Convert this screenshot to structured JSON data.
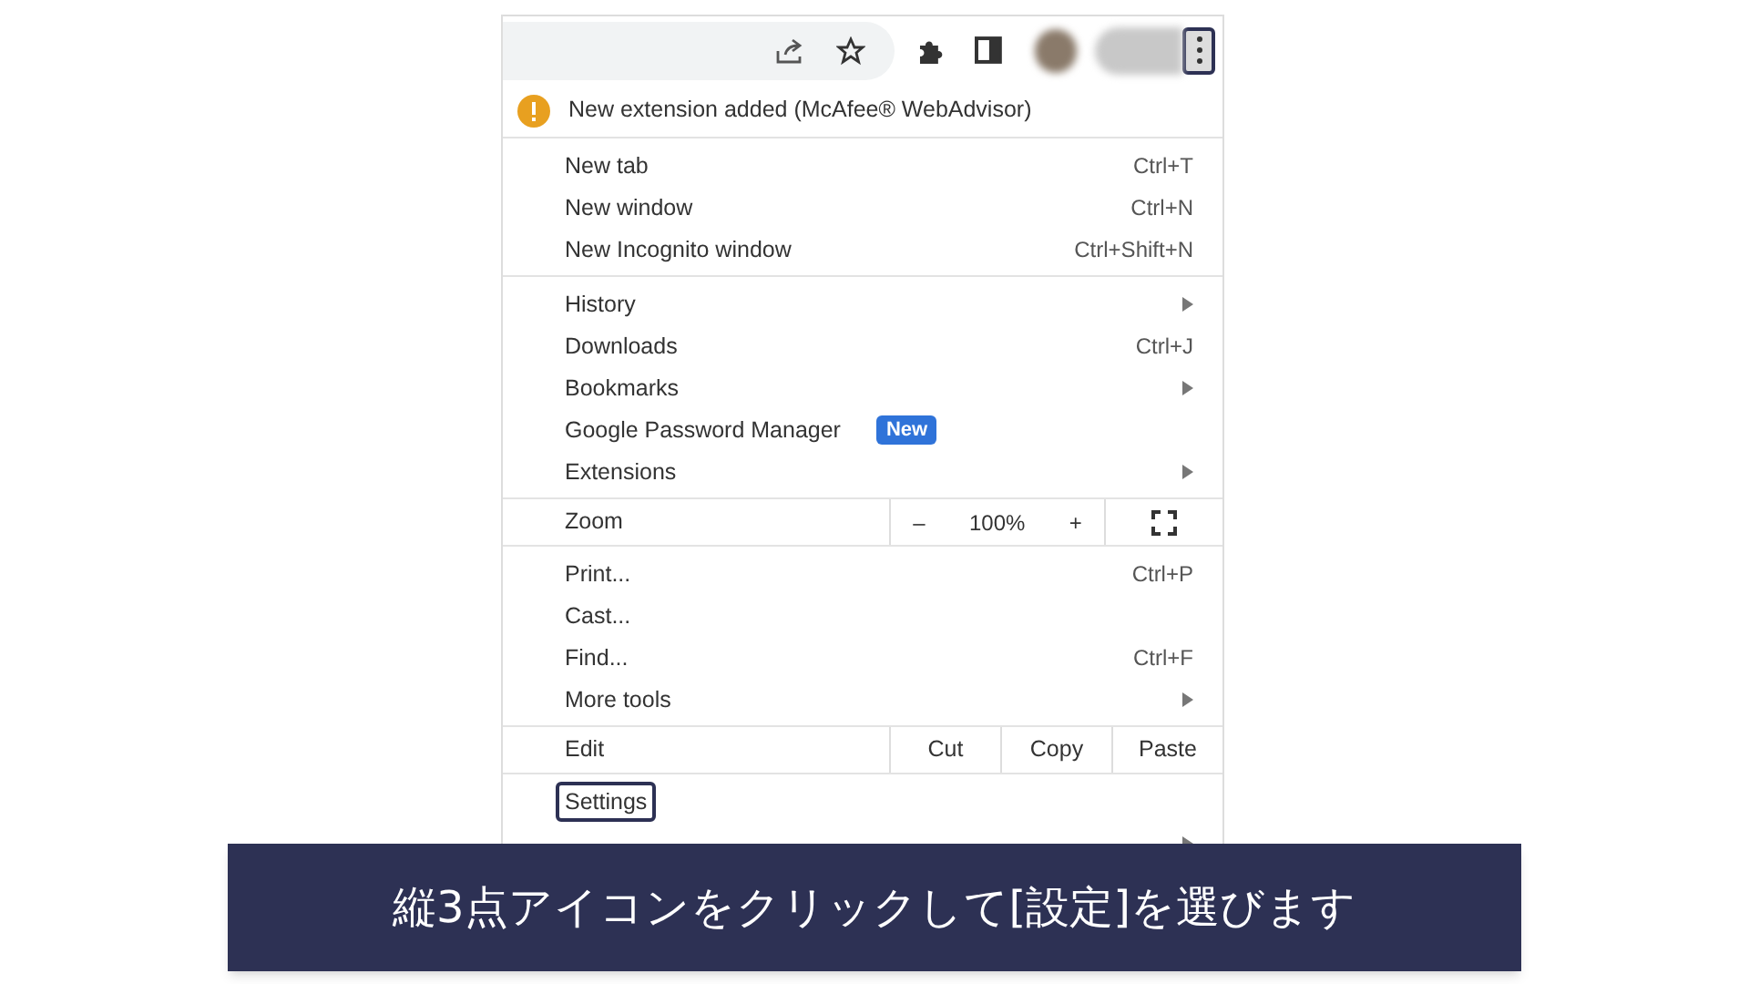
{
  "toolbar": {
    "menu_button": {
      "outlined": true
    }
  },
  "notice": {
    "text": "New extension added (McAfee® WebAdvisor)"
  },
  "menu": {
    "sections": [
      [
        {
          "kind": "item",
          "label": "New tab",
          "shortcut": "Ctrl+T",
          "submenu": false,
          "outlined": false
        },
        {
          "kind": "item",
          "label": "New window",
          "shortcut": "Ctrl+N",
          "submenu": false,
          "outlined": false
        },
        {
          "kind": "item",
          "label": "New Incognito window",
          "shortcut": "Ctrl+Shift+N",
          "submenu": false,
          "outlined": false
        }
      ],
      [
        {
          "kind": "item",
          "label": "History",
          "submenu": true,
          "outlined": false
        },
        {
          "kind": "item",
          "label": "Downloads",
          "shortcut": "Ctrl+J",
          "submenu": false,
          "outlined": false
        },
        {
          "kind": "item",
          "label": "Bookmarks",
          "submenu": true,
          "outlined": false
        },
        {
          "kind": "item",
          "label": "Google Password Manager",
          "badge": "New",
          "submenu": false,
          "outlined": false
        },
        {
          "kind": "item",
          "label": "Extensions",
          "submenu": true,
          "outlined": false
        }
      ],
      [
        {
          "kind": "zoom",
          "label": "Zoom",
          "minus": "–",
          "value": "100%",
          "plus": "+"
        }
      ],
      [
        {
          "kind": "item",
          "label": "Print...",
          "shortcut": "Ctrl+P",
          "submenu": false,
          "outlined": false
        },
        {
          "kind": "item",
          "label": "Cast...",
          "submenu": false,
          "outlined": false
        },
        {
          "kind": "item",
          "label": "Find...",
          "shortcut": "Ctrl+F",
          "submenu": false,
          "outlined": false
        },
        {
          "kind": "item",
          "label": "More tools",
          "submenu": true,
          "outlined": false
        }
      ],
      [
        {
          "kind": "edit",
          "label": "Edit",
          "buttons": [
            "Cut",
            "Copy",
            "Paste"
          ]
        }
      ],
      [
        {
          "kind": "item",
          "label": "Settings",
          "submenu": false,
          "outlined": true
        },
        {
          "kind": "item",
          "submenu": true
        }
      ]
    ]
  },
  "caption": "縦3点アイコンをクリックして[設定]を選びます"
}
